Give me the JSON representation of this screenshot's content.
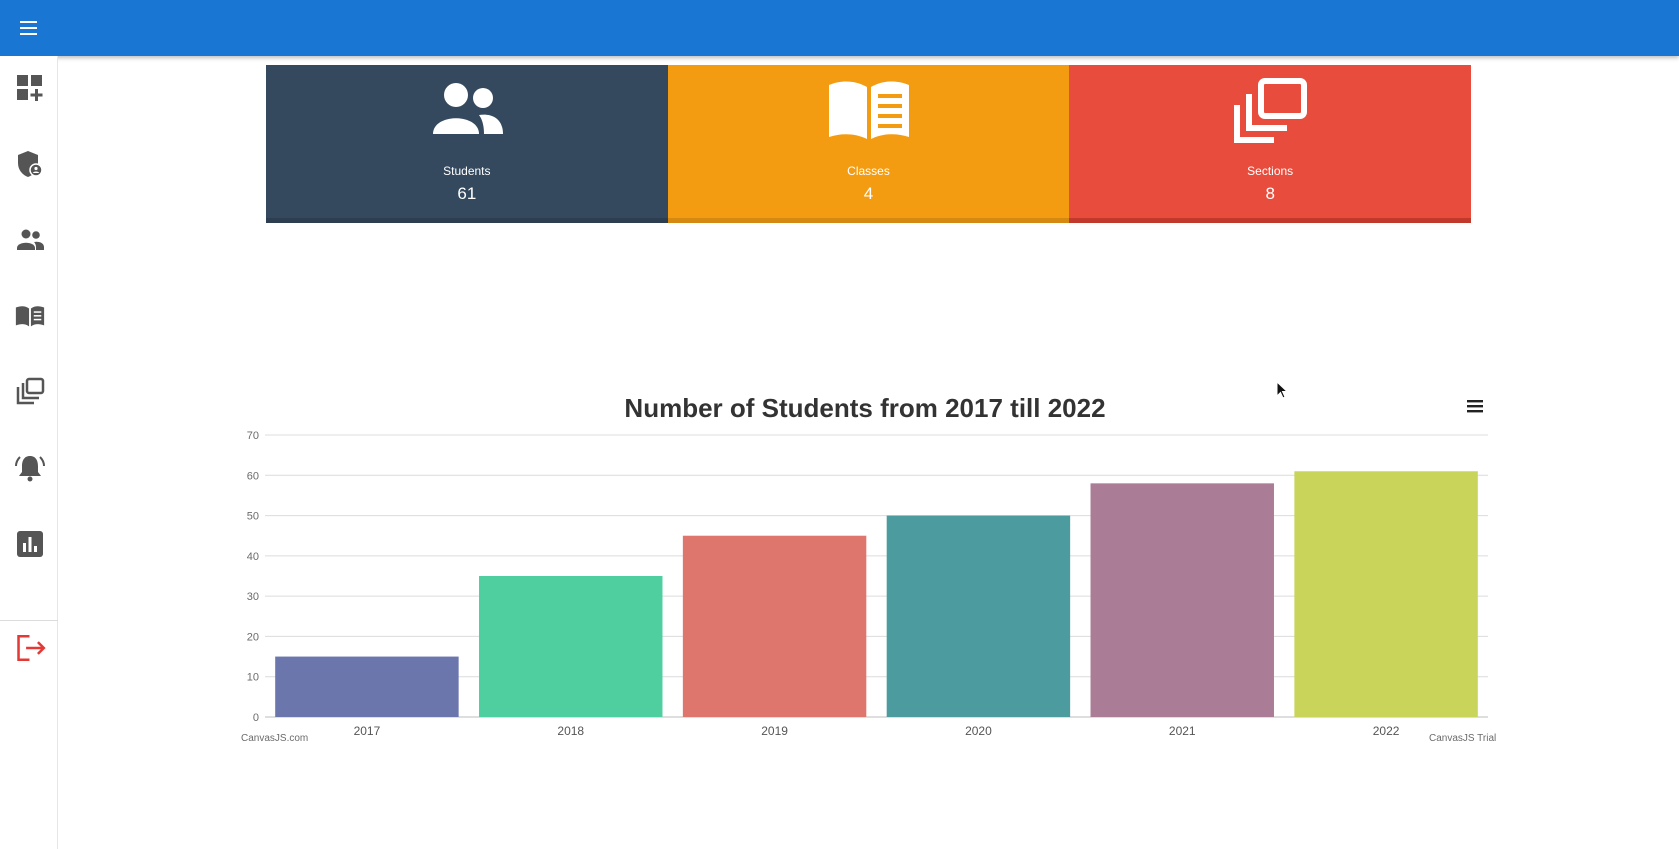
{
  "colors": {
    "topbar": "#1976d2",
    "students_card": "#34495e",
    "classes_card": "#f39c12",
    "sections_card": "#e74c3c",
    "sidebar_icon": "#555555",
    "logout_icon": "#e53935"
  },
  "header": {
    "menu_icon": "hamburger-menu-icon"
  },
  "sidebar": {
    "items": [
      {
        "icon": "dashboard-add-icon"
      },
      {
        "icon": "shield-admin-icon"
      },
      {
        "icon": "students-icon"
      },
      {
        "icon": "classes-book-icon"
      },
      {
        "icon": "sections-library-icon"
      },
      {
        "icon": "notifications-alarm-icon"
      },
      {
        "icon": "reports-chart-icon"
      },
      {
        "icon": "logout-icon"
      }
    ]
  },
  "cards": [
    {
      "label": "Students",
      "value": "61",
      "icon": "people-icon"
    },
    {
      "label": "Classes",
      "value": "4",
      "icon": "book-icon"
    },
    {
      "label": "Sections",
      "value": "8",
      "icon": "library-icon"
    }
  ],
  "chart_data": {
    "type": "bar",
    "title": "Number of Students from 2017 till 2022",
    "categories": [
      "2017",
      "2018",
      "2019",
      "2020",
      "2021",
      "2022"
    ],
    "values": [
      15,
      35,
      45,
      50,
      58,
      61
    ],
    "colors": [
      "#6b76ad",
      "#4fcea0",
      "#df766d",
      "#4b9b9f",
      "#ab7c95",
      "#c8d55a"
    ],
    "ylim": [
      0,
      70
    ],
    "yticks": [
      0,
      10,
      20,
      30,
      40,
      50,
      60,
      70
    ],
    "xlabel": "",
    "ylabel": "",
    "grid": true,
    "legend": "none",
    "credit_left": "CanvasJS.com",
    "credit_right": "CanvasJS Trial"
  }
}
